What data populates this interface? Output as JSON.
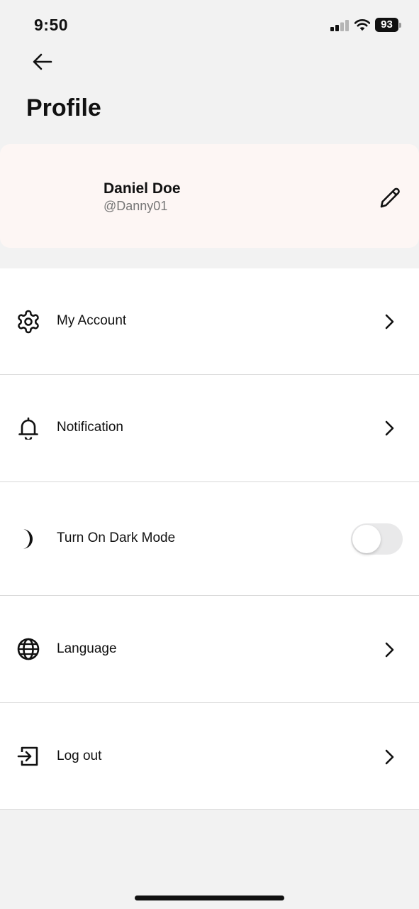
{
  "status_bar": {
    "time": "9:50",
    "battery_level": "93",
    "signal_icon": "cellular-signal-icon",
    "wifi_icon": "wifi-icon"
  },
  "header": {
    "back_icon": "arrow-left-icon",
    "title": "Profile"
  },
  "profile": {
    "name": "Daniel Doe",
    "handle": "@Danny01",
    "edit_icon": "pencil-icon"
  },
  "settings": {
    "items": [
      {
        "label": "My Account",
        "icon": "gear-icon",
        "control": "chevron"
      },
      {
        "label": "Notification",
        "icon": "bell-icon",
        "control": "chevron"
      },
      {
        "label": "Turn On Dark Mode",
        "icon": "moon-icon",
        "control": "toggle",
        "toggle_on": false
      },
      {
        "label": "Language",
        "icon": "globe-icon",
        "control": "chevron"
      },
      {
        "label": "Log out",
        "icon": "logout-icon",
        "control": "chevron"
      }
    ]
  },
  "colors": {
    "background": "#f2f2f2",
    "card": "#fdf6f4",
    "list_background": "#ffffff",
    "divider": "#d9d9d9",
    "toggle_off": "#e9e9ea",
    "text": "#111111",
    "secondary_text": "#777777"
  }
}
